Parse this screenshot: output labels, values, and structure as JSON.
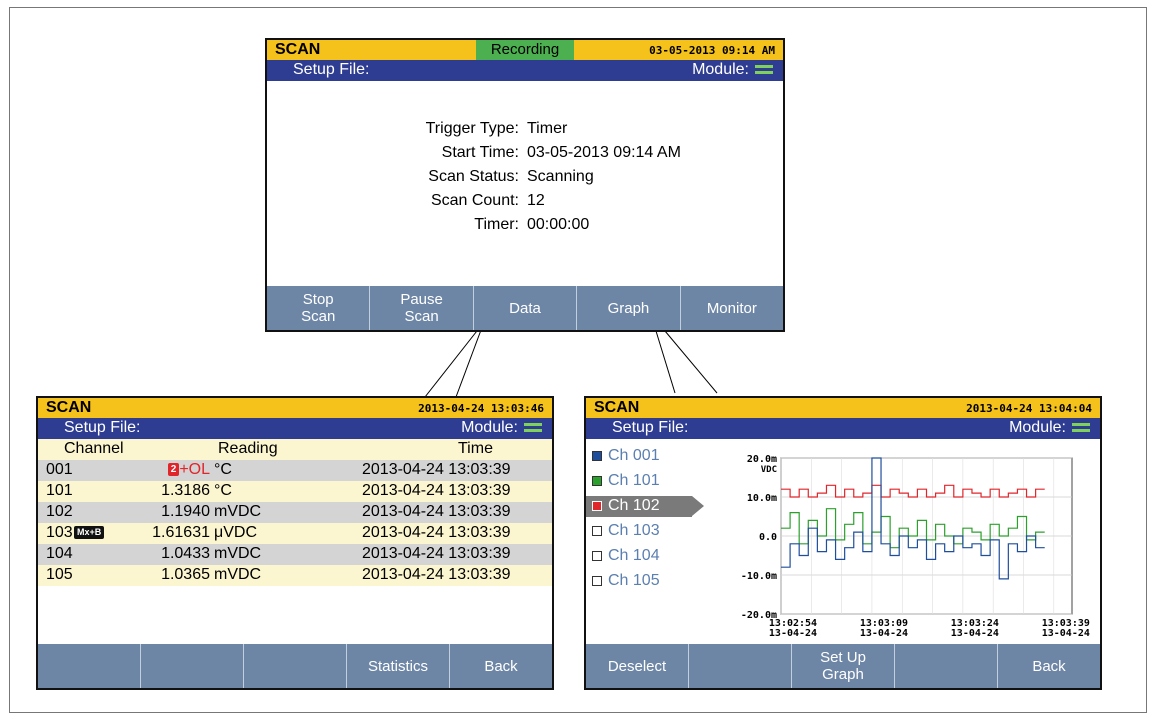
{
  "top_screen": {
    "title": "SCAN",
    "status": "Recording",
    "datetime": "03-05-2013 09:14 AM",
    "setup_label": "Setup File:",
    "module_label": "Module:",
    "info": [
      {
        "label": "Trigger Type:",
        "value": "Timer"
      },
      {
        "label": "Start Time:",
        "value": "03-05-2013 09:14 AM"
      },
      {
        "label": "Scan Status:",
        "value": "Scanning"
      },
      {
        "label": "Scan Count:",
        "value": "12"
      },
      {
        "label": "Timer:",
        "value": "00:00:00"
      }
    ],
    "softkeys": [
      {
        "line1": "Stop",
        "line2": "Scan"
      },
      {
        "line1": "Pause",
        "line2": "Scan"
      },
      {
        "line1": "Data",
        "line2": ""
      },
      {
        "line1": "Graph",
        "line2": ""
      },
      {
        "line1": "Monitor",
        "line2": ""
      }
    ]
  },
  "data_screen": {
    "title": "SCAN",
    "datetime": "2013-04-24 13:03:46",
    "setup_label": "Setup File:",
    "module_label": "Module:",
    "headers": {
      "channel": "Channel",
      "reading": "Reading",
      "time": "Time"
    },
    "rows": [
      {
        "channel": "001",
        "badge": "2",
        "reading_value": "+OL",
        "reading_unit": "°C",
        "time": "2013-04-24 13:03:39"
      },
      {
        "channel": "101",
        "badge": "",
        "reading_value": "1.3186",
        "reading_unit": "°C",
        "time": "2013-04-24 13:03:39"
      },
      {
        "channel": "102",
        "badge": "",
        "reading_value": "1.1940",
        "reading_unit": "mVDC",
        "time": "2013-04-24 13:03:39"
      },
      {
        "channel": "103",
        "badge": "Mx+B",
        "reading_value": "1.61631",
        "reading_unit": "μVDC",
        "time": "2013-04-24 13:03:39"
      },
      {
        "channel": "104",
        "badge": "",
        "reading_value": "1.0433",
        "reading_unit": "mVDC",
        "time": "2013-04-24 13:03:39"
      },
      {
        "channel": "105",
        "badge": "",
        "reading_value": "1.0365",
        "reading_unit": "mVDC",
        "time": "2013-04-24 13:03:39"
      }
    ],
    "softkeys": [
      {
        "line1": "",
        "line2": ""
      },
      {
        "line1": "",
        "line2": ""
      },
      {
        "line1": "",
        "line2": ""
      },
      {
        "line1": "Statistics",
        "line2": ""
      },
      {
        "line1": "Back",
        "line2": ""
      }
    ]
  },
  "graph_screen": {
    "title": "SCAN",
    "datetime": "2013-04-24 13:04:04",
    "setup_label": "Setup File:",
    "module_label": "Module:",
    "channels": [
      {
        "label": "Ch 001",
        "color": "#1f4e9c",
        "selected": false
      },
      {
        "label": "Ch 101",
        "color": "#2ca02c",
        "selected": false
      },
      {
        "label": "Ch 102",
        "color": "#e0262b",
        "selected": true
      },
      {
        "label": "Ch 103",
        "color": "#ffffff",
        "selected": false
      },
      {
        "label": "Ch 104",
        "color": "#ffffff",
        "selected": false
      },
      {
        "label": "Ch 105",
        "color": "#ffffff",
        "selected": false
      }
    ],
    "softkeys": [
      {
        "line1": "Deselect",
        "line2": ""
      },
      {
        "line1": "",
        "line2": ""
      },
      {
        "line1": "Set Up",
        "line2": "Graph"
      },
      {
        "line1": "",
        "line2": ""
      },
      {
        "line1": "Back",
        "line2": ""
      }
    ]
  },
  "chart_data": {
    "type": "line",
    "ylabel": "VDC",
    "ylim": [
      -20.0,
      20.0
    ],
    "y_ticks": [
      "20.0m",
      "10.0m",
      "0.0",
      "-10.0m",
      "-20.0m"
    ],
    "y_tick_values": [
      20,
      10,
      0,
      -10,
      -20
    ],
    "x_ticks": [
      {
        "time": "13:02:54",
        "date": "13-04-24"
      },
      {
        "time": "13:03:09",
        "date": "13-04-24"
      },
      {
        "time": "13:03:24",
        "date": "13-04-24"
      },
      {
        "time": "13:03:39",
        "date": "13-04-24"
      }
    ],
    "x_tick_values": [
      0,
      15,
      30,
      45
    ],
    "xlim": [
      0,
      48
    ],
    "grid": true,
    "series": [
      {
        "channel": "Ch 102",
        "color": "#e0262b",
        "x": [
          0,
          1.5,
          3,
          4.5,
          6,
          7.5,
          9,
          10.5,
          12,
          13.5,
          15,
          16.5,
          18,
          19.5,
          21,
          22.5,
          24,
          25.5,
          27,
          28.5,
          30,
          31.5,
          33,
          34.5,
          36,
          37.5,
          39,
          40.5,
          42
        ],
        "values": [
          12,
          10,
          12,
          10,
          11,
          13,
          10,
          12,
          10,
          11,
          13,
          10,
          12,
          11,
          10,
          12,
          10,
          11,
          13,
          10,
          12,
          11,
          10,
          12,
          10,
          11,
          12,
          10,
          12
        ]
      },
      {
        "channel": "Ch 101",
        "color": "#2ca02c",
        "x": [
          0,
          1.5,
          3,
          4.5,
          6,
          7.5,
          9,
          10.5,
          12,
          13.5,
          15,
          16.5,
          18,
          19.5,
          21,
          22.5,
          24,
          25.5,
          27,
          28.5,
          30,
          31.5,
          33,
          34.5,
          36,
          37.5,
          39,
          40.5,
          42
        ],
        "values": [
          2,
          6,
          -2,
          4,
          0,
          7,
          -1,
          3,
          6,
          -2,
          1,
          5,
          -3,
          2,
          0,
          4,
          -1,
          3,
          0,
          -2,
          2,
          1,
          -1,
          3,
          0,
          2,
          5,
          -1,
          1
        ]
      },
      {
        "channel": "Ch 001",
        "color": "#1f4e9c",
        "x": [
          0,
          1.5,
          3,
          4.5,
          6,
          7.5,
          9,
          10.5,
          12,
          13.5,
          15,
          16.5,
          18,
          19.5,
          21,
          22.5,
          24,
          25.5,
          27,
          28.5,
          30,
          31.5,
          33,
          34.5,
          36,
          37.5,
          39,
          40.5,
          42
        ],
        "values": [
          -8,
          -2,
          -5,
          2,
          -4,
          -1,
          -6,
          -3,
          1,
          -4,
          20,
          -2,
          -5,
          0,
          -3,
          -1,
          -6,
          -2,
          -4,
          0,
          -3,
          -2,
          -5,
          -1,
          -11,
          -2,
          -4,
          0,
          -3
        ]
      }
    ]
  }
}
